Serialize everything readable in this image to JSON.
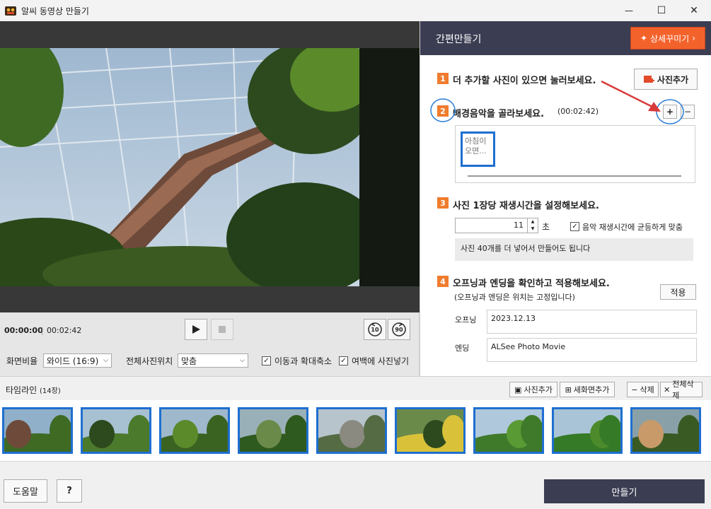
{
  "window": {
    "title": "알씨 동영상 만들기",
    "minimize": "—",
    "maximize": "☐",
    "close": "✕"
  },
  "player": {
    "current_time": "00:00:00",
    "total_time": "00:02:42",
    "rewind_label": "10",
    "forward_label": "90"
  },
  "options": {
    "aspect_label": "화면비율",
    "aspect_value": "와이드 (16:9)",
    "position_label": "전체사진위치",
    "position_value": "맞춤",
    "move_zoom_label": "이동과 확대축소",
    "move_zoom_checked": true,
    "fill_margin_label": "여백에 사진넣기",
    "fill_margin_checked": true
  },
  "panel": {
    "title": "간편만들기",
    "detail_button": "상세꾸미기",
    "step1": {
      "num": "1",
      "text": "더 추가할 사진이 있으면 눌러보세요.",
      "button": "사진추가"
    },
    "step2": {
      "num": "2",
      "text": "배경음악을 골라보세요.",
      "duration": "(00:02:42)",
      "add": "+",
      "remove": "−",
      "music_title": "아침이\n오면..."
    },
    "step3": {
      "num": "3",
      "text": "사진 1장당 재생시간을 설정해보세요.",
      "seconds": "11",
      "unit": "초",
      "fit_label": "음악 재생시간에 균등하게 맞춤",
      "fit_checked": true,
      "info": "사진 40개를 더 넣어서 만들어도 됩니다"
    },
    "step4": {
      "num": "4",
      "text": "오프닝과 엔딩을 확인하고 적용해보세요.",
      "note": "(오프닝과 엔딩은 위치는 고정입니다)",
      "apply": "적용",
      "opening_label": "오프닝",
      "opening_value": "2023.12.13",
      "ending_label": "엔딩",
      "ending_value": "ALSee Photo Movie"
    }
  },
  "timeline": {
    "title": "타임라인",
    "count": "(14장)",
    "add_photo": "사진추가",
    "new_screen": "새화면추가",
    "delete": "삭제",
    "delete_all": "전체삭제",
    "thumb_count": 9
  },
  "bottom": {
    "help": "도움말",
    "question": "?",
    "make": "만들기"
  },
  "colors": {
    "accent_orange": "#f4622b",
    "header_dark": "#3b3d52",
    "selection_blue": "#1e6fd0",
    "annotation_blue": "#2c7fd6",
    "annotation_red": "#d93a3a"
  }
}
